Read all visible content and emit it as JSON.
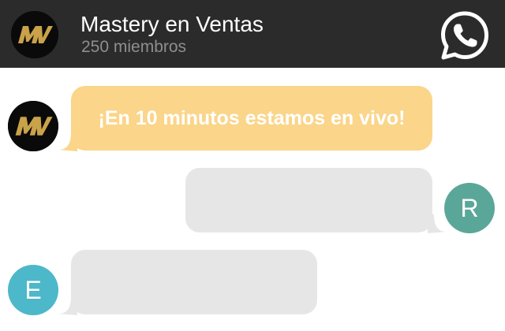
{
  "header": {
    "title": "Mastery en Ventas",
    "subtitle": "250 miembros",
    "avatar_logo": "MV",
    "whatsapp_icon": "whatsapp-icon"
  },
  "messages": [
    {
      "sender_logo": "MV",
      "text": "¡En 10 minutos estamos en vivo!",
      "bubble_color": "#fad58a"
    },
    {
      "sender_initial": "R",
      "text": "",
      "bubble_color": "#e6e6e6",
      "avatar_color": "#5aa79a"
    },
    {
      "sender_initial": "E",
      "text": "",
      "bubble_color": "#e6e6e6",
      "avatar_color": "#4db8c9"
    }
  ],
  "colors": {
    "header_bg": "#2b2b2b",
    "accent_gold": "#c9a24a"
  }
}
